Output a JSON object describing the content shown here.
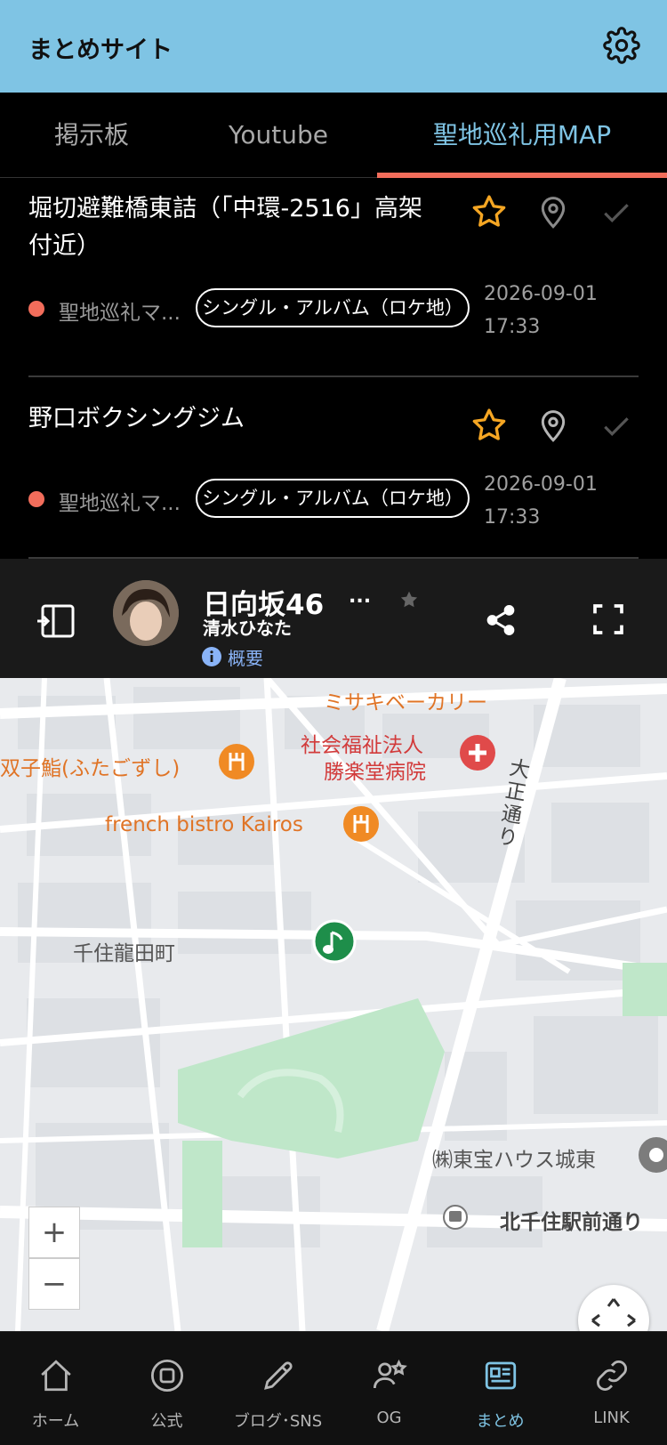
{
  "appbar": {
    "title": "まとめサイト",
    "settings_icon": "gear-icon"
  },
  "tabs": [
    {
      "label": "掲示板",
      "active": false
    },
    {
      "label": "Youtube",
      "active": false
    },
    {
      "label": "聖地巡礼用MAP",
      "active": true
    }
  ],
  "colors": {
    "accent": "#7fc4e4",
    "indicator": "#f26d5b",
    "star": "#f5a623",
    "pin_green": "#1e8e4a"
  },
  "items": [
    {
      "title": "堀切避難橋東詰（「中環-2516」高架付近）",
      "category": "聖地巡礼マ...",
      "tag": "シングル・アルバム（ロケ地）",
      "date": "2026-09-01",
      "time": "17:33"
    },
    {
      "title": "野口ボクシングジム",
      "category": "聖地巡礼マ...",
      "tag": "シングル・アルバム（ロケ地）",
      "date": "2026-09-01",
      "time": "17:33"
    }
  ],
  "map_header": {
    "title": "日向坂46",
    "more": "...",
    "subtitle": "清水ひなた",
    "info_label": "概要"
  },
  "map": {
    "labels": {
      "bakery": "ミサキベーカリー",
      "hospital_1": "社会福祉法人",
      "hospital_2": "勝楽堂病院",
      "sushi": "双子鮨(ふたごずし)",
      "bistro": "french bistro Kairos",
      "street": "大正通り",
      "town": "千住龍田町",
      "company": "㈱東宝ハウス城東",
      "road": "北千住駅前通り"
    },
    "zoom_in": "+",
    "zoom_out": "−"
  },
  "bottomnav": [
    {
      "label": "ホーム",
      "icon": "home-icon",
      "active": false
    },
    {
      "label": "公式",
      "icon": "official-icon",
      "active": false
    },
    {
      "label": "ブログ･SNS",
      "icon": "pencil-icon",
      "active": false
    },
    {
      "label": "OG",
      "icon": "og-icon",
      "active": false
    },
    {
      "label": "まとめ",
      "icon": "news-icon",
      "active": true
    },
    {
      "label": "LINK",
      "icon": "link-icon",
      "active": false
    }
  ]
}
